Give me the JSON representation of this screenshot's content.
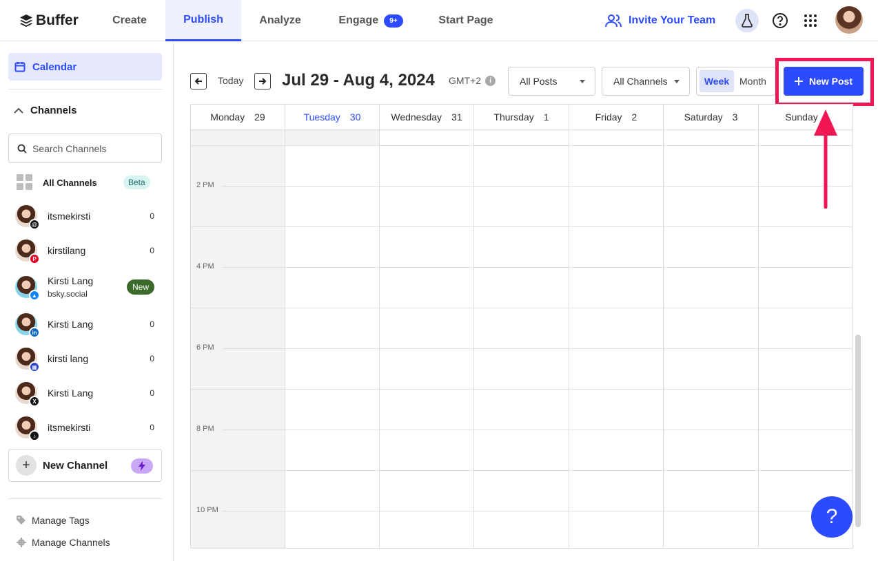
{
  "nav": {
    "logo": "Buffer",
    "tabs": [
      {
        "label": "Create"
      },
      {
        "label": "Publish"
      },
      {
        "label": "Analyze"
      },
      {
        "label": "Engage",
        "badge": "9+"
      },
      {
        "label": "Start Page"
      }
    ],
    "invite": "Invite Your Team",
    "icons": [
      "labs-flask-icon",
      "help-icon",
      "apps-grid-icon"
    ]
  },
  "sidebar": {
    "calendar": "Calendar",
    "channels_heading": "Channels",
    "search_placeholder": "Search Channels",
    "all_channels": {
      "label": "All Channels",
      "badge": "Beta"
    },
    "channels": [
      {
        "name": "itsmekirsti",
        "network": "threads",
        "count": "0"
      },
      {
        "name": "kirstilang",
        "network": "pinterest",
        "count": "0"
      },
      {
        "name": "Kirsti Lang",
        "sub": "bsky.social",
        "network": "bluesky",
        "badge": "New"
      },
      {
        "name": "Kirsti Lang",
        "network": "linkedin",
        "count": "0"
      },
      {
        "name": "kirsti lang",
        "network": "google-business",
        "count": "0"
      },
      {
        "name": "Kirsti Lang",
        "network": "x",
        "count": "0"
      },
      {
        "name": "itsmekirsti",
        "network": "tiktok",
        "count": "0"
      }
    ],
    "new_channel": "New Channel",
    "manage_tags": "Manage Tags",
    "manage_channels": "Manage Channels"
  },
  "toolbar": {
    "today": "Today",
    "date_range": "Jul 29 - Aug 4, 2024",
    "timezone": "GMT+2",
    "posts_filter": "All Posts",
    "channels_filter": "All Channels",
    "view_week": "Week",
    "view_month": "Month",
    "new_post": "New Post"
  },
  "calendar": {
    "days": [
      {
        "name": "Monday",
        "num": "29"
      },
      {
        "name": "Tuesday",
        "num": "30"
      },
      {
        "name": "Wednesday",
        "num": "31"
      },
      {
        "name": "Thursday",
        "num": "1"
      },
      {
        "name": "Friday",
        "num": "2"
      },
      {
        "name": "Saturday",
        "num": "3"
      },
      {
        "name": "Sunday",
        "num": ""
      }
    ],
    "times": [
      "2 PM",
      "4 PM",
      "6 PM",
      "8 PM",
      "10 PM"
    ]
  },
  "help_fab": "?",
  "colors": {
    "brand": "#2c4bff",
    "annotation": "#ef1653"
  }
}
